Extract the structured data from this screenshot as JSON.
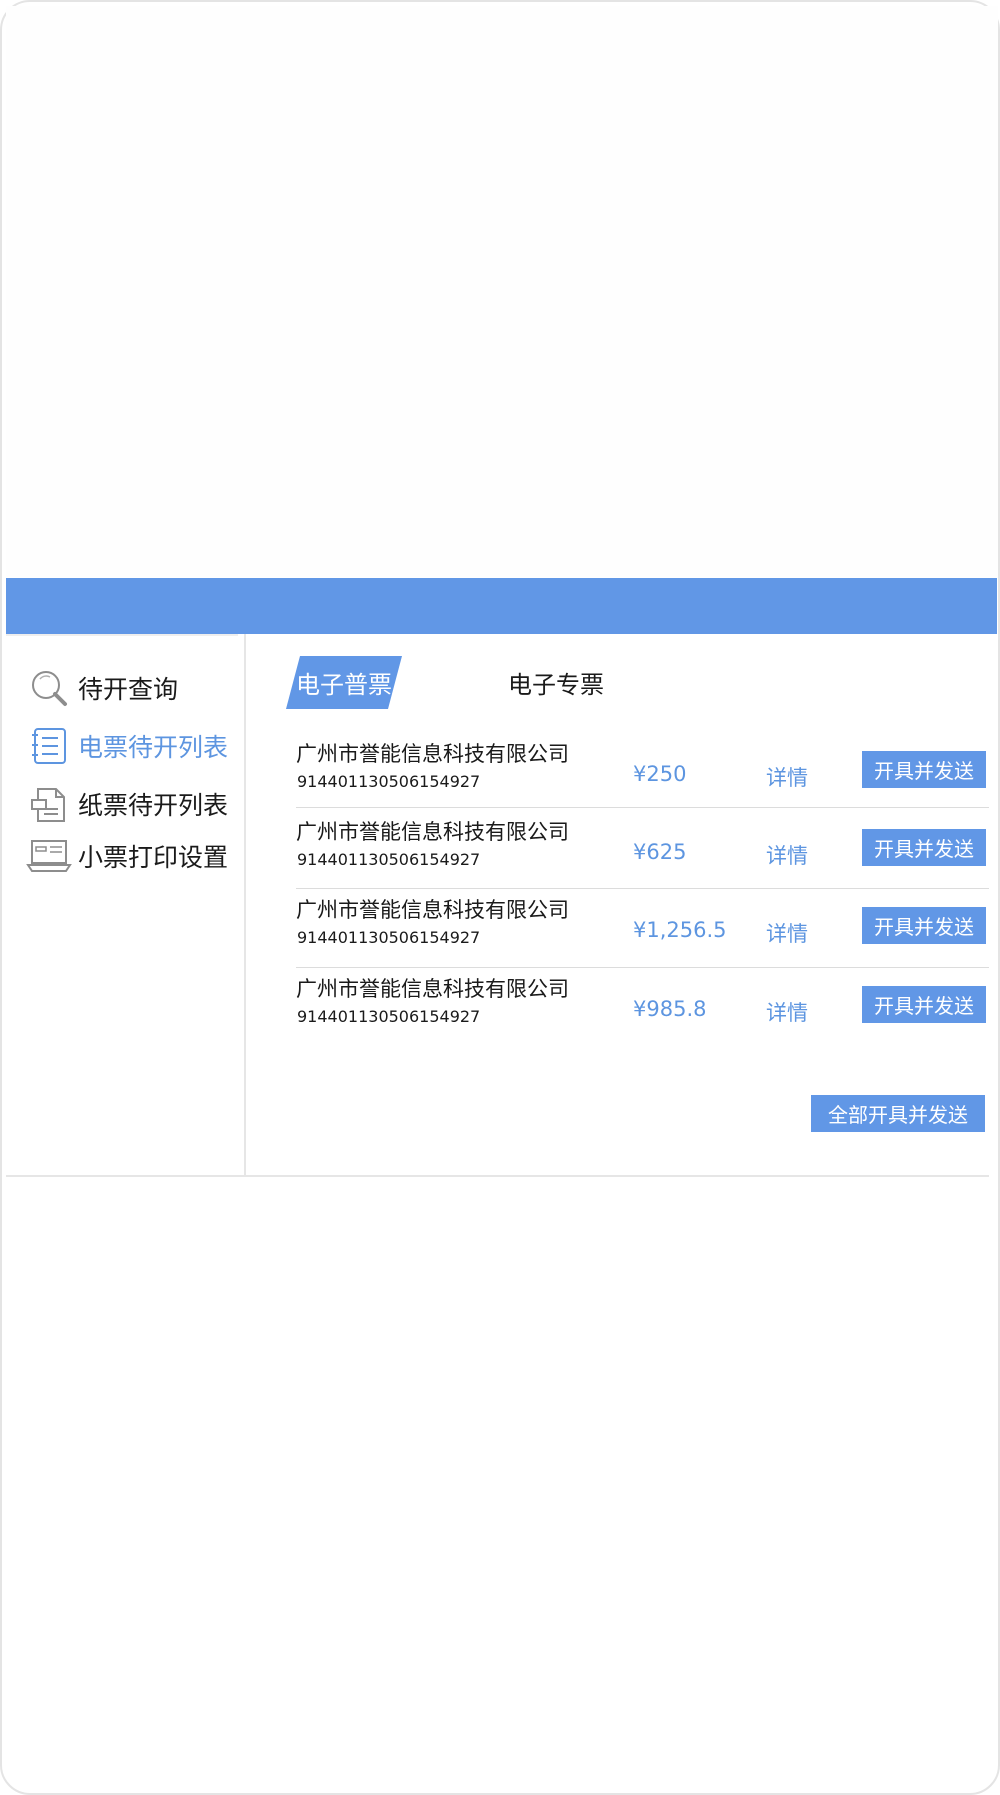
{
  "colors": {
    "accent": "#6197e6",
    "link": "#5d95e0",
    "text": "#1a1a1a",
    "divider": "#dcdcdc"
  },
  "sidebar": {
    "items": [
      {
        "label": "待开查询",
        "icon": "search-icon",
        "active": false
      },
      {
        "label": "电票待开列表",
        "icon": "list-document-icon",
        "active": true
      },
      {
        "label": "纸票待开列表",
        "icon": "paper-invoice-icon",
        "active": false
      },
      {
        "label": "小票打印设置",
        "icon": "printer-icon",
        "active": false
      }
    ]
  },
  "tabs": [
    {
      "label": "电子普票",
      "active": true
    },
    {
      "label": "电子专票",
      "active": false
    }
  ],
  "invoices": [
    {
      "company": "广州市誉能信息科技有限公司",
      "tax_id": "914401130506154927",
      "amount": "¥250",
      "details": "详情",
      "action": "开具并发送"
    },
    {
      "company": "广州市誉能信息科技有限公司",
      "tax_id": "914401130506154927",
      "amount": "¥625",
      "details": "详情",
      "action": "开具并发送"
    },
    {
      "company": "广州市誉能信息科技有限公司",
      "tax_id": "914401130506154927",
      "amount": "¥1,256.5",
      "details": "详情",
      "action": "开具并发送"
    },
    {
      "company": "广州市誉能信息科技有限公司",
      "tax_id": "914401130506154927",
      "amount": "¥985.8",
      "details": "详情",
      "action": "开具并发送"
    }
  ],
  "footer": {
    "issue_all_label": "全部开具并发送"
  }
}
